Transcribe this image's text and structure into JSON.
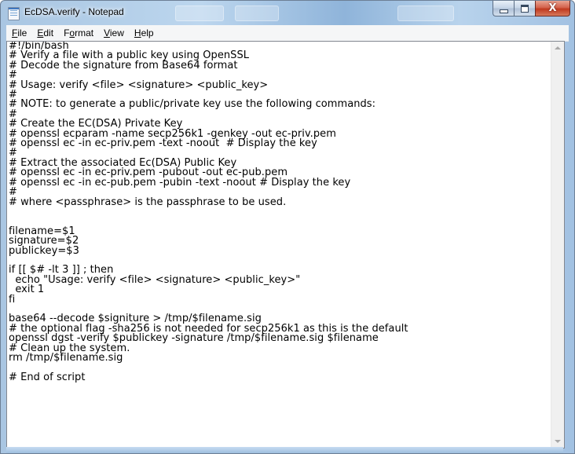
{
  "window": {
    "title": "EcDSA.verify - Notepad",
    "colors": {
      "frame": "#b5cfe9",
      "close_button": "#c9452b",
      "editor_bg": "#ffffff"
    }
  },
  "caption_buttons": {
    "minimize_icon": "minimize-icon",
    "maximize_icon": "maximize-icon",
    "close_label": "X"
  },
  "menu": [
    {
      "label": "File",
      "accel": "F",
      "rest": "ile"
    },
    {
      "label": "Edit",
      "accel": "E",
      "rest": "dit"
    },
    {
      "label": "Format",
      "accel": "o",
      "pre": "F",
      "rest": "rmat"
    },
    {
      "label": "View",
      "accel": "V",
      "rest": "iew"
    },
    {
      "label": "Help",
      "accel": "H",
      "rest": "elp"
    }
  ],
  "editor": {
    "content": "#!/bin/bash\n# Verify a file with a public key using OpenSSL\n# Decode the signature from Base64 format\n#\n# Usage: verify <file> <signature> <public_key>\n#\n# NOTE: to generate a public/private key use the following commands:\n#\n# Create the EC(DSA) Private Key\n# openssl ecparam -name secp256k1 -genkey -out ec-priv.pem\n# openssl ec -in ec-priv.pem -text -noout  # Display the key\n#\n# Extract the associated Ec(DSA) Public Key\n# openssl ec -in ec-priv.pem -pubout -out ec-pub.pem\n# openssl ec -in ec-pub.pem -pubin -text -noout # Display the key\n#\n# where <passphrase> is the passphrase to be used.\n\n\nfilename=$1\nsignature=$2\npublickey=$3\n\nif [[ $# -lt 3 ]] ; then\n  echo \"Usage: verify <file> <signature> <public_key>\"\n  exit 1\nfi\n\nbase64 --decode $signiture > /tmp/$filename.sig\n# the optional flag -sha256 is not needed for secp256k1 as this is the default\nopenssl dgst -verify $publickey -signature /tmp/$filename.sig $filename\n# Clean up the system.\nrm /tmp/$filename.sig\n\n# End of script"
  }
}
